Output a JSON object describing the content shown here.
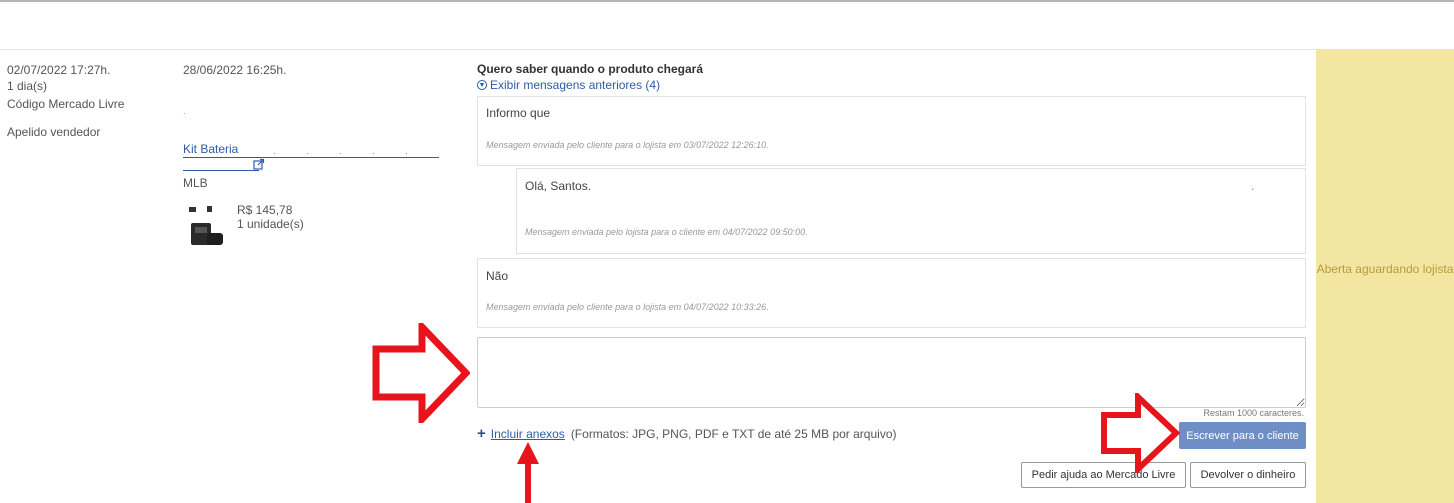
{
  "left_info": {
    "datetime": "02/07/2022 17:27h.",
    "elapsed": "1 dia(s)",
    "code_label": "Código Mercado Livre",
    "seller_label": "Apelido vendedor"
  },
  "purchase": {
    "datetime": "28/06/2022 16:25h.",
    "code_value": ".",
    "product_name": "Kit Bateria",
    "site": "MLB",
    "price": "R$ 145,78",
    "units": "1 unidade(s)"
  },
  "conversation": {
    "subject": "Quero saber quando o produto chegará",
    "show_previous": "Exibir mensagens anteriores (4)",
    "messages": [
      {
        "text": "Informo que",
        "meta": "Mensagem enviada pelo cliente para o lojista em 03/07/2022 12:26:10."
      },
      {
        "text": "Olá, Santos.",
        "trailing": ".",
        "meta": "Mensagem enviada pelo lojista para o cliente em 04/07/2022 09:50:00."
      },
      {
        "text": "Não",
        "meta": "Mensagem enviada pelo cliente para o lojista em 04/07/2022 10:33:26."
      }
    ],
    "reply_value": "",
    "remaining": "Restam 1000 caracteres.",
    "attach_link": "Incluir anexos",
    "attach_hint": "(Formatos: JPG, PNG, PDF e TXT de até 25 MB por arquivo)",
    "send_button": "Escrever para o cliente",
    "help_button": "Pedir ajuda ao Mercado Livre",
    "refund_button": "Devolver o dinheiro"
  },
  "status": {
    "text": "Aberta aguardando lojista"
  },
  "colors": {
    "link": "#2d5ca8",
    "primary_button": "#6f8ec6",
    "status_bg": "#f3e6a3",
    "status_text": "#b89b3a",
    "annotation_arrow": "#e8141c"
  }
}
